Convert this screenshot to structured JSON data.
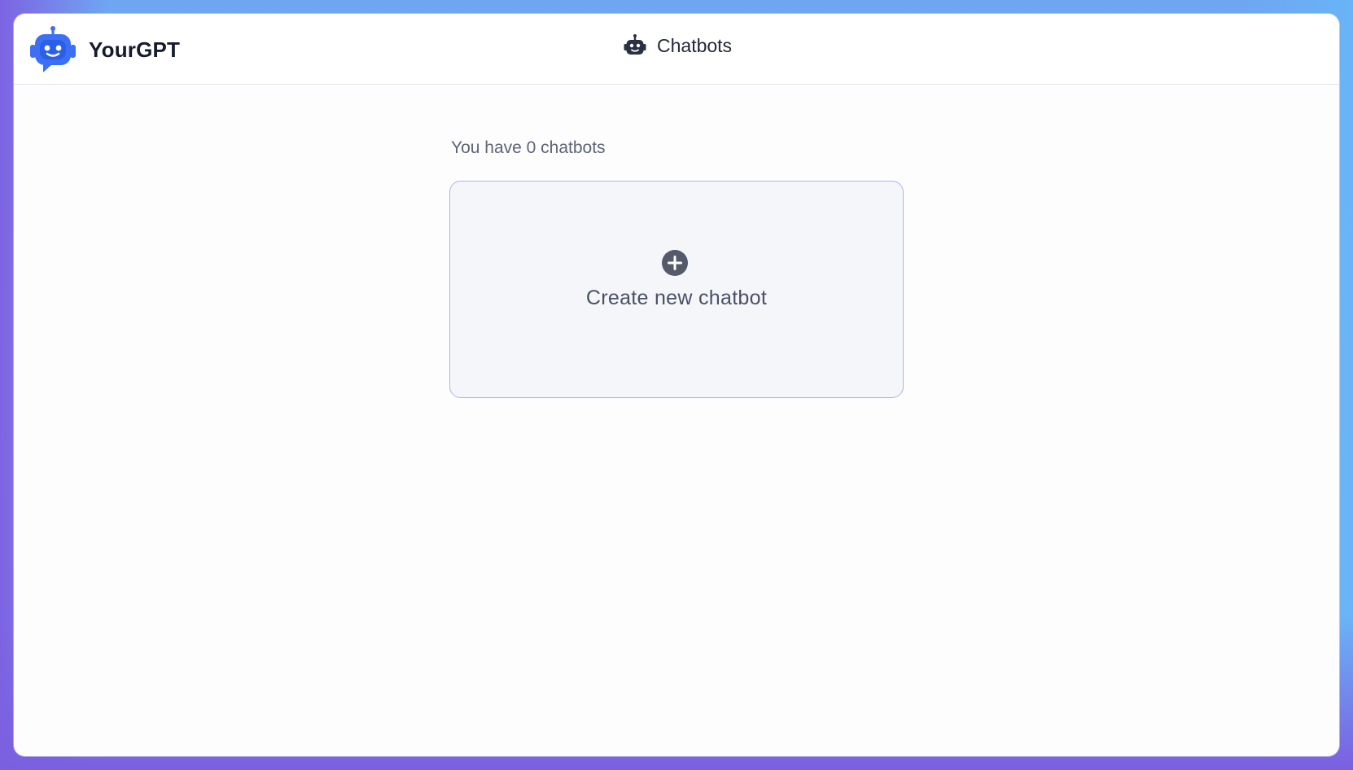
{
  "app": {
    "name": "YourGPT",
    "logo_icon": "robot-chat-logo-icon",
    "brand_color": "#3b6ff5"
  },
  "nav": {
    "icon": "robot-icon",
    "label": "Chatbots"
  },
  "main": {
    "count_text": "You have 0 chatbots",
    "create_card": {
      "icon": "plus-circle-icon",
      "label": "Create new chatbot"
    }
  },
  "colors": {
    "card_border": "#a9b5ec",
    "card_background": "#f5f6f9",
    "text_primary": "#151a2d",
    "text_muted": "#5d6378"
  }
}
